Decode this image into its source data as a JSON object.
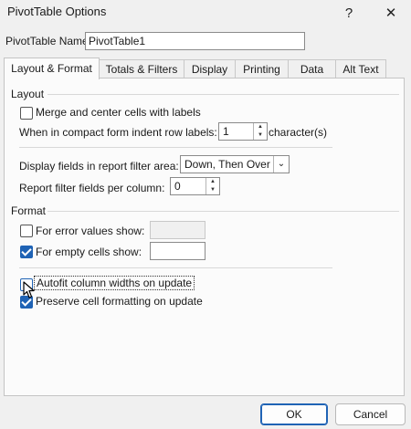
{
  "window": {
    "title": "PivotTable Options",
    "help_glyph": "?",
    "close_glyph": "✕"
  },
  "pivot_name": {
    "label": "PivotTable Name:",
    "value": "PivotTable1"
  },
  "tabs": [
    {
      "label": "Layout & Format",
      "active": true
    },
    {
      "label": "Totals & Filters",
      "active": false
    },
    {
      "label": "Display",
      "active": false
    },
    {
      "label": "Printing",
      "active": false
    },
    {
      "label": "Data",
      "active": false
    },
    {
      "label": "Alt Text",
      "active": false
    }
  ],
  "layout_section": {
    "title": "Layout",
    "merge_label": "Merge and center cells with labels",
    "merge_checked": false,
    "indent_label": "When in compact form indent row labels:",
    "indent_value": "1",
    "indent_suffix": "character(s)",
    "display_fields_label": "Display fields in report filter area:",
    "display_fields_value": "Down, Then Over",
    "report_filter_label": "Report filter fields per column:",
    "report_filter_value": "0"
  },
  "format_section": {
    "title": "Format",
    "error_label": "For error values show:",
    "error_checked": false,
    "error_value": "",
    "empty_label": "For empty cells show:",
    "empty_checked": true,
    "empty_value": "",
    "autofit_label": "Autofit column widths on update",
    "autofit_checked": false,
    "preserve_label": "Preserve cell formatting on update",
    "preserve_checked": true
  },
  "buttons": {
    "ok": "OK",
    "cancel": "Cancel"
  },
  "colors": {
    "accent": "#1f63b5",
    "background": "#f0f0f0",
    "panel": "#fbfbfb"
  }
}
